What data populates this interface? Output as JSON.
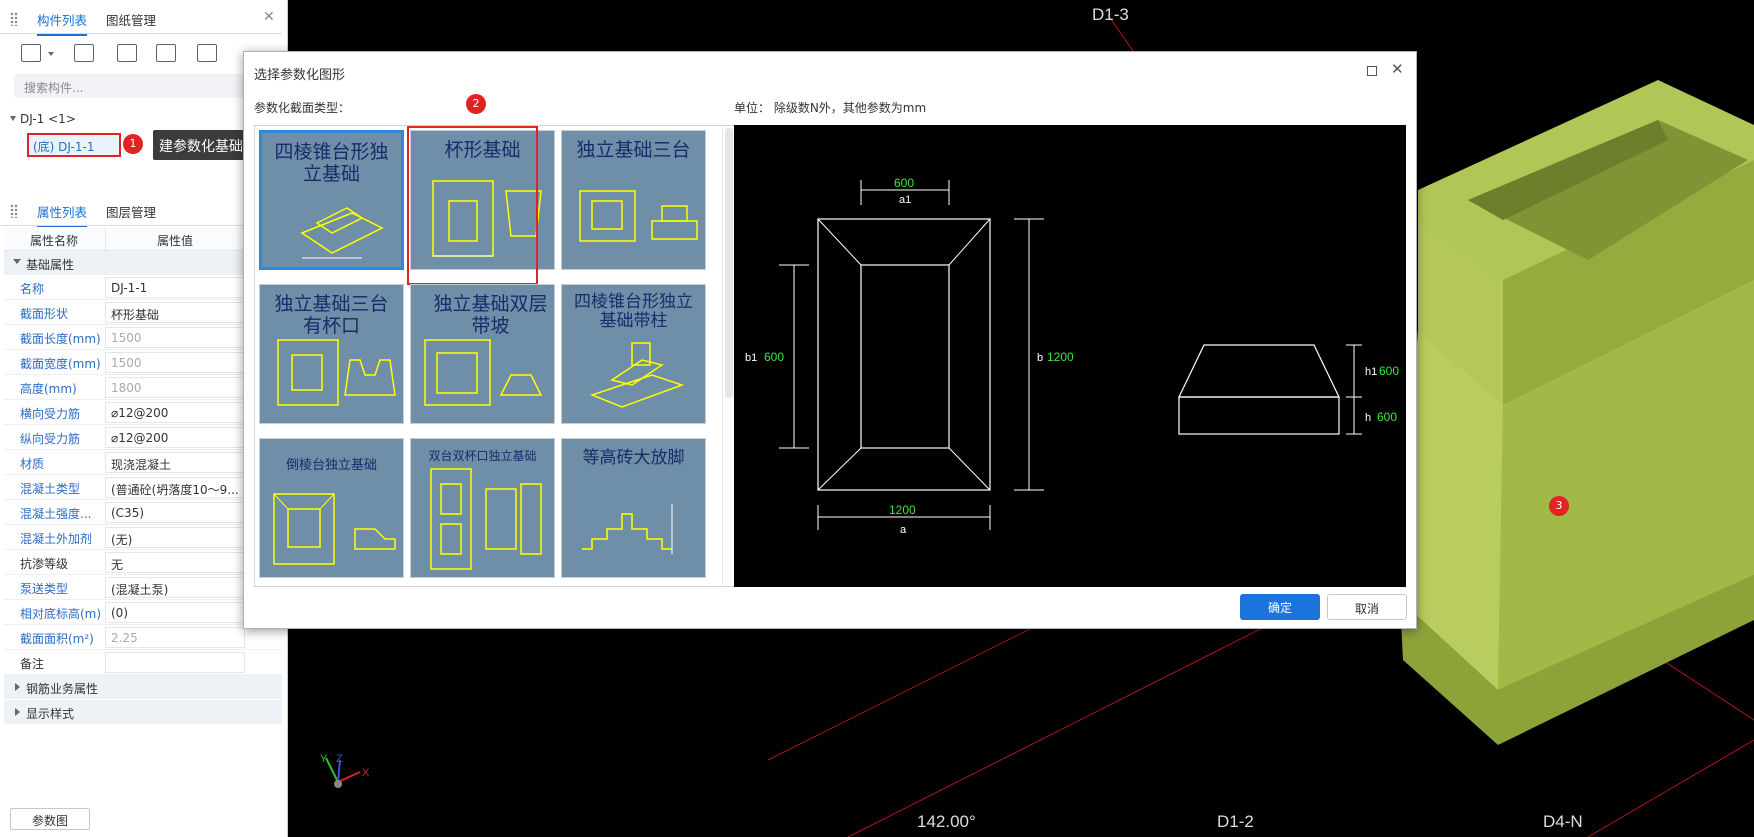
{
  "left_panel": {
    "tabs": [
      "构件列表",
      "图纸管理"
    ],
    "search_placeholder": "搜索构件...",
    "tree_parent": "DJ-1 <1>",
    "tree_child": "(底) DJ-1-1",
    "callout_1": "建参数化基础单元",
    "props_tabs": [
      "属性列表",
      "图层管理"
    ],
    "col_headers": [
      "属性名称",
      "属性值"
    ],
    "section_base": "基础属性",
    "properties": [
      {
        "name": "名称",
        "value": "DJ-1-1",
        "grey": false
      },
      {
        "name": "截面形状",
        "value": "杯形基础",
        "grey": false
      },
      {
        "name": "截面长度(mm)",
        "value": "1500",
        "grey": true
      },
      {
        "name": "截面宽度(mm)",
        "value": "1500",
        "grey": true
      },
      {
        "name": "高度(mm)",
        "value": "1800",
        "grey": true
      },
      {
        "name": "横向受力筋",
        "value": "⌀12@200",
        "grey": false
      },
      {
        "name": "纵向受力筋",
        "value": "⌀12@200",
        "grey": false
      },
      {
        "name": "材质",
        "value": "现浇混凝土",
        "grey": false
      },
      {
        "name": "混凝土类型",
        "value": "(普通砼(坍落度10～9...",
        "grey": false
      },
      {
        "name": "混凝土强度...",
        "value": "(C35)",
        "grey": false
      },
      {
        "name": "混凝土外加剂",
        "value": "(无)",
        "grey": false
      },
      {
        "name": "抗渗等级",
        "value": "无",
        "grey": false,
        "black": true
      },
      {
        "name": "泵送类型",
        "value": "(混凝土泵)",
        "grey": false
      },
      {
        "name": "相对底标高(m)",
        "value": "(0)",
        "grey": false
      },
      {
        "name": "截面面积(m²)",
        "value": "2.25",
        "grey": true
      },
      {
        "name": "备注",
        "value": "",
        "grey": false,
        "black": true
      }
    ],
    "section_rebar": "钢筋业务属性",
    "section_display": "显示样式",
    "param_button": "参数图"
  },
  "dialog": {
    "title": "选择参数化图形",
    "type_label": "参数化截面类型：",
    "unit_label": "单位：  除级数N外，其他参数为mm",
    "thumbnails": [
      "四棱锥台形独立基础",
      "杯形基础",
      "独立基础三台",
      "独立基础三台有杯口",
      "独立基础双层带坡",
      "四棱锥台形独立基础带柱",
      "倒棱台独立基础",
      "双台双杯口独立基础",
      "等高砖大放脚"
    ],
    "preview": {
      "a1": "600",
      "a1_label": "a1",
      "b1": "600",
      "b1_label": "b1",
      "b": "1200",
      "b_label": "b",
      "a": "1200",
      "a_label": "a",
      "h1": "600",
      "h1_label": "h1",
      "h": "600",
      "h_label": "h"
    },
    "ok": "确定",
    "cancel": "取消"
  },
  "viewport": {
    "axis_labels": [
      "D1-3",
      "D1-2",
      "D4-N"
    ],
    "angle": "142.00°",
    "model_color": "#a7bf4a"
  },
  "badges": [
    "1",
    "2",
    "3"
  ]
}
